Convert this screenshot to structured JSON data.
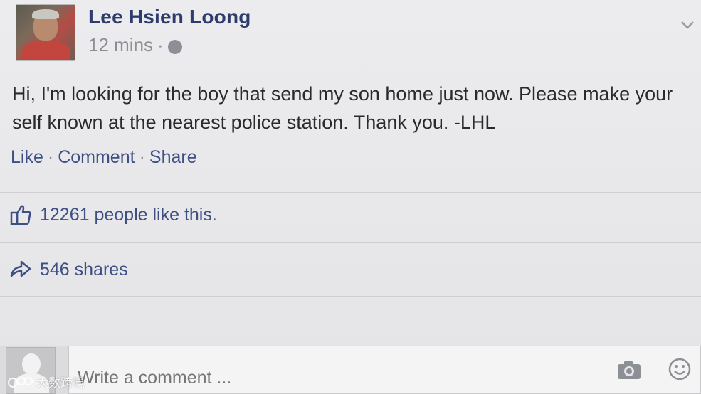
{
  "post": {
    "author": "Lee Hsien Loong",
    "timestamp": "12 mins",
    "meta_separator": "·",
    "privacy_icon": "globe-icon",
    "text": "Hi, I'm looking for the boy that send my son home just now. Please make your self known at the nearest police station. Thank you. -LHL",
    "actions": {
      "like": "Like",
      "comment": "Comment",
      "share": "Share",
      "separator": "·"
    }
  },
  "stats": {
    "likes_text": "12261 people like this.",
    "shares_text": "546 shares"
  },
  "comment_box": {
    "placeholder": "Write a comment ..."
  },
  "watermark": {
    "text": "大数跨境"
  },
  "colors": {
    "name_blue": "#2d3c6b",
    "link_blue": "#3d4f83",
    "meta_gray": "#8d8f96",
    "text_dark": "#2a2a2e"
  }
}
